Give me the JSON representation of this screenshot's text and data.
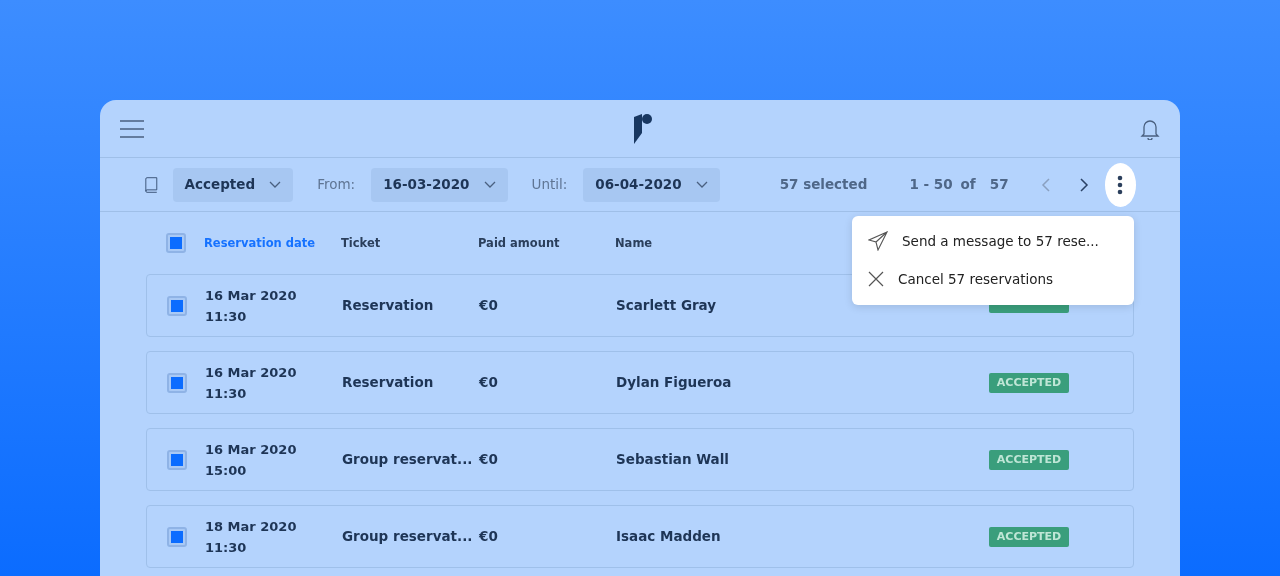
{
  "toolbar": {
    "status_filter": "Accepted",
    "from_label": "From:",
    "from_date": "16-03-2020",
    "until_label": "Until:",
    "until_date": "06-04-2020",
    "selected_count": "57 selected",
    "range": "1 - 50",
    "of_label": "of",
    "total": "57"
  },
  "menu": {
    "open": true,
    "items": [
      {
        "kind": "send",
        "label": "Send a message to 57 rese..."
      },
      {
        "kind": "cancel",
        "label": "Cancel 57 reservations"
      }
    ]
  },
  "table": {
    "all_checked": true,
    "columns": [
      {
        "label": "Reservation date",
        "sorted": true
      },
      {
        "label": "Ticket",
        "sorted": false
      },
      {
        "label": "Paid amount",
        "sorted": false
      },
      {
        "label": "Name",
        "sorted": false
      }
    ],
    "rows": [
      {
        "checked": true,
        "date": "16 Mar 2020",
        "time": "11:30",
        "ticket": "Reservation",
        "paid": "€0",
        "name": "Scarlett Gray"
      },
      {
        "checked": true,
        "date": "16 Mar 2020",
        "time": "11:30",
        "ticket": "Reservation",
        "paid": "€0",
        "name": "Dylan Figueroa",
        "status": "ACCEPTED"
      },
      {
        "checked": true,
        "date": "16 Mar 2020",
        "time": "15:00",
        "ticket": "Group reservat...",
        "paid": "€0",
        "name": "Sebastian Wall",
        "status": "ACCEPTED"
      },
      {
        "checked": true,
        "date": "18 Mar 2020",
        "time": "11:30",
        "ticket": "Group reservat...",
        "paid": "€0",
        "name": "Isaac Madden",
        "status": "ACCEPTED"
      }
    ]
  }
}
